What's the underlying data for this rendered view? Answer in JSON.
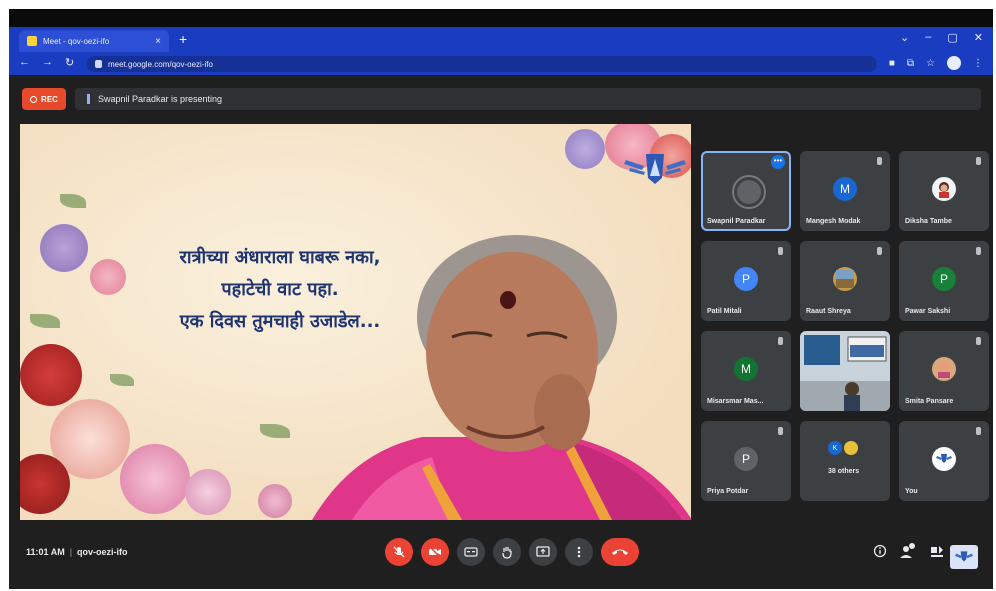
{
  "browser": {
    "tab_title": "Meet - qov-oezi-ifo",
    "tab_close": "×",
    "new_tab": "+",
    "url": "meet.google.com/qov-oezi-ifo",
    "win_controls": [
      "⌄",
      "–",
      "▢",
      "✕"
    ]
  },
  "meet": {
    "rec_label": "REC",
    "presenting_text": "Swapnil Paradkar is presenting",
    "time": "11:01 AM",
    "meeting_code": "qov-oezi-ifo"
  },
  "slide": {
    "quote_lines": [
      "रात्रीच्या अंधाराला घाबरू नका,",
      "पहाटेची वाट पहा.",
      "एक दिवस तुमचाही उजाडेल..."
    ]
  },
  "participants": [
    {
      "name": "Swapnil Paradkar",
      "initial": "",
      "color": "#5f6368",
      "active": true
    },
    {
      "name": "Mangesh Modak",
      "initial": "M",
      "color": "#1967d2"
    },
    {
      "name": "Diksha Tambe",
      "initial": "",
      "color": "#f1f3f4"
    },
    {
      "name": "Patil Mitali",
      "initial": "P",
      "color": "#4285f4"
    },
    {
      "name": "Raaut Shreya",
      "initial": "",
      "color": "#c89b4a"
    },
    {
      "name": "Pawar Sakshi",
      "initial": "P",
      "color": "#188038"
    },
    {
      "name": "Misarsmar Mas...",
      "initial": "M",
      "color": "#137333"
    },
    {
      "name": "",
      "initial": "",
      "color": "#2a3b4f"
    },
    {
      "name": "Smita Pansare",
      "initial": "",
      "color": "#d9a77b"
    },
    {
      "name": "Priya Potdar",
      "initial": "P",
      "color": "#5f6368"
    },
    {
      "name": "38 others",
      "initial": "K",
      "color": "#1967d2"
    },
    {
      "name": "You",
      "initial": "",
      "color": "#ffffff"
    }
  ],
  "colors": {
    "tab_bar": "#1a3cc0",
    "meet_bg": "#1f1f1f",
    "tile_bg": "#3c4043",
    "accent_red": "#ea4335",
    "highlight": "#8ab4f8"
  },
  "icons": {
    "controls": [
      "mic-off-icon",
      "camera-off-icon",
      "captions-icon",
      "raise-hand-icon",
      "present-icon",
      "more-icon",
      "end-call-icon"
    ],
    "right": [
      "info-icon",
      "people-icon",
      "activities-icon"
    ]
  }
}
